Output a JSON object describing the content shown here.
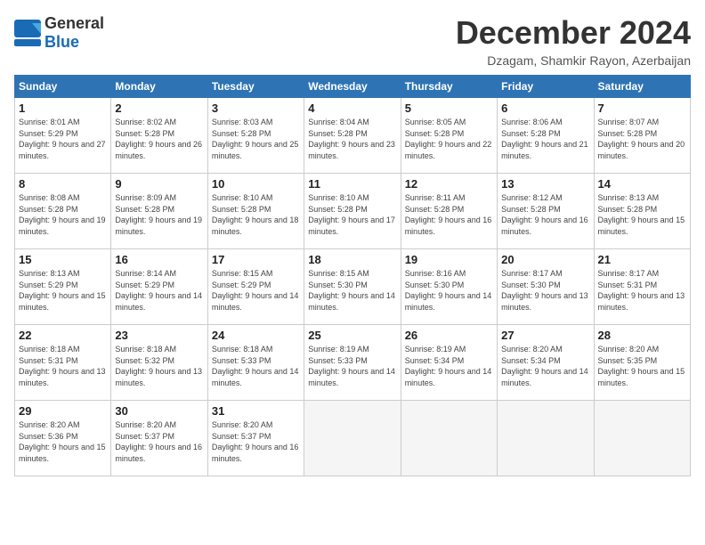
{
  "logo": {
    "general": "General",
    "blue": "Blue"
  },
  "title": "December 2024",
  "location": "Dzagam, Shamkir Rayon, Azerbaijan",
  "headers": [
    "Sunday",
    "Monday",
    "Tuesday",
    "Wednesday",
    "Thursday",
    "Friday",
    "Saturday"
  ],
  "weeks": [
    [
      {
        "day": "1",
        "sunrise": "8:01 AM",
        "sunset": "5:29 PM",
        "daylight": "9 hours and 27 minutes."
      },
      {
        "day": "2",
        "sunrise": "8:02 AM",
        "sunset": "5:28 PM",
        "daylight": "9 hours and 26 minutes."
      },
      {
        "day": "3",
        "sunrise": "8:03 AM",
        "sunset": "5:28 PM",
        "daylight": "9 hours and 25 minutes."
      },
      {
        "day": "4",
        "sunrise": "8:04 AM",
        "sunset": "5:28 PM",
        "daylight": "9 hours and 23 minutes."
      },
      {
        "day": "5",
        "sunrise": "8:05 AM",
        "sunset": "5:28 PM",
        "daylight": "9 hours and 22 minutes."
      },
      {
        "day": "6",
        "sunrise": "8:06 AM",
        "sunset": "5:28 PM",
        "daylight": "9 hours and 21 minutes."
      },
      {
        "day": "7",
        "sunrise": "8:07 AM",
        "sunset": "5:28 PM",
        "daylight": "9 hours and 20 minutes."
      }
    ],
    [
      {
        "day": "8",
        "sunrise": "8:08 AM",
        "sunset": "5:28 PM",
        "daylight": "9 hours and 19 minutes."
      },
      {
        "day": "9",
        "sunrise": "8:09 AM",
        "sunset": "5:28 PM",
        "daylight": "9 hours and 19 minutes."
      },
      {
        "day": "10",
        "sunrise": "8:10 AM",
        "sunset": "5:28 PM",
        "daylight": "9 hours and 18 minutes."
      },
      {
        "day": "11",
        "sunrise": "8:10 AM",
        "sunset": "5:28 PM",
        "daylight": "9 hours and 17 minutes."
      },
      {
        "day": "12",
        "sunrise": "8:11 AM",
        "sunset": "5:28 PM",
        "daylight": "9 hours and 16 minutes."
      },
      {
        "day": "13",
        "sunrise": "8:12 AM",
        "sunset": "5:28 PM",
        "daylight": "9 hours and 16 minutes."
      },
      {
        "day": "14",
        "sunrise": "8:13 AM",
        "sunset": "5:28 PM",
        "daylight": "9 hours and 15 minutes."
      }
    ],
    [
      {
        "day": "15",
        "sunrise": "8:13 AM",
        "sunset": "5:29 PM",
        "daylight": "9 hours and 15 minutes."
      },
      {
        "day": "16",
        "sunrise": "8:14 AM",
        "sunset": "5:29 PM",
        "daylight": "9 hours and 14 minutes."
      },
      {
        "day": "17",
        "sunrise": "8:15 AM",
        "sunset": "5:29 PM",
        "daylight": "9 hours and 14 minutes."
      },
      {
        "day": "18",
        "sunrise": "8:15 AM",
        "sunset": "5:30 PM",
        "daylight": "9 hours and 14 minutes."
      },
      {
        "day": "19",
        "sunrise": "8:16 AM",
        "sunset": "5:30 PM",
        "daylight": "9 hours and 14 minutes."
      },
      {
        "day": "20",
        "sunrise": "8:17 AM",
        "sunset": "5:30 PM",
        "daylight": "9 hours and 13 minutes."
      },
      {
        "day": "21",
        "sunrise": "8:17 AM",
        "sunset": "5:31 PM",
        "daylight": "9 hours and 13 minutes."
      }
    ],
    [
      {
        "day": "22",
        "sunrise": "8:18 AM",
        "sunset": "5:31 PM",
        "daylight": "9 hours and 13 minutes."
      },
      {
        "day": "23",
        "sunrise": "8:18 AM",
        "sunset": "5:32 PM",
        "daylight": "9 hours and 13 minutes."
      },
      {
        "day": "24",
        "sunrise": "8:18 AM",
        "sunset": "5:33 PM",
        "daylight": "9 hours and 14 minutes."
      },
      {
        "day": "25",
        "sunrise": "8:19 AM",
        "sunset": "5:33 PM",
        "daylight": "9 hours and 14 minutes."
      },
      {
        "day": "26",
        "sunrise": "8:19 AM",
        "sunset": "5:34 PM",
        "daylight": "9 hours and 14 minutes."
      },
      {
        "day": "27",
        "sunrise": "8:20 AM",
        "sunset": "5:34 PM",
        "daylight": "9 hours and 14 minutes."
      },
      {
        "day": "28",
        "sunrise": "8:20 AM",
        "sunset": "5:35 PM",
        "daylight": "9 hours and 15 minutes."
      }
    ],
    [
      {
        "day": "29",
        "sunrise": "8:20 AM",
        "sunset": "5:36 PM",
        "daylight": "9 hours and 15 minutes."
      },
      {
        "day": "30",
        "sunrise": "8:20 AM",
        "sunset": "5:37 PM",
        "daylight": "9 hours and 16 minutes."
      },
      {
        "day": "31",
        "sunrise": "8:20 AM",
        "sunset": "5:37 PM",
        "daylight": "9 hours and 16 minutes."
      },
      null,
      null,
      null,
      null
    ]
  ]
}
